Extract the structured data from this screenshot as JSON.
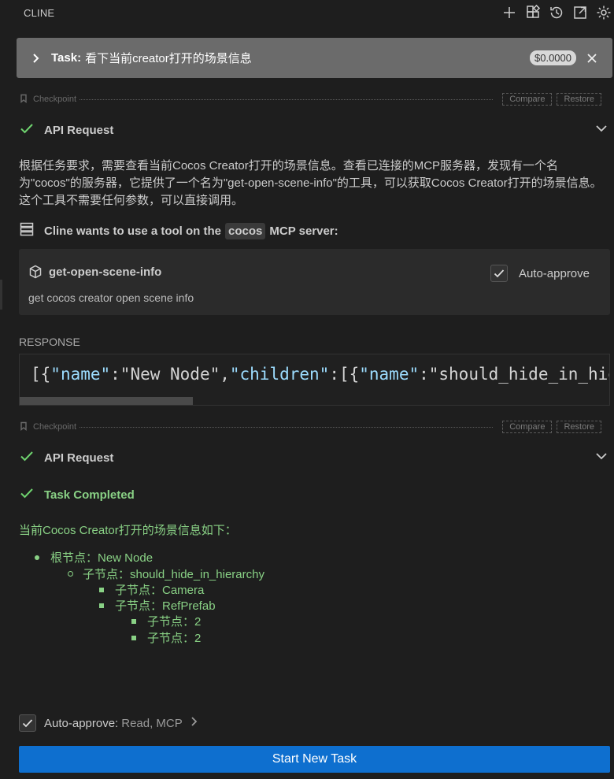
{
  "header": {
    "title": "CLINE",
    "icons": [
      "plus-icon",
      "grid-icon",
      "history-icon",
      "external-link-icon",
      "gear-icon"
    ]
  },
  "task": {
    "label": "Task:",
    "text": "看下当前creator打开的场景信息",
    "cost": "$0.0000"
  },
  "checkpoint": {
    "label": "Checkpoint",
    "compare": "Compare",
    "restore": "Restore"
  },
  "api_request_1": {
    "title": "API Request"
  },
  "reasoning": "根据任务要求，需要查看当前Cocos Creator打开的场景信息。查看已连接的MCP服务器，发现有一个名为\"cocos\"的服务器，它提供了一个名为\"get-open-scene-info\"的工具，可以获取Cocos Creator打开的场景信息。这个工具不需要任何参数，可以直接调用。",
  "tool_use": {
    "prefix": "Cline wants to use a tool on the",
    "server": "cocos",
    "suffix": "MCP server:"
  },
  "tool_card": {
    "name": "get-open-scene-info",
    "description": "get cocos creator open scene info",
    "auto_approve": "Auto-approve"
  },
  "response": {
    "label": "RESPONSE",
    "tokens": {
      "open": "[{",
      "key1": "\"name\"",
      "sep1": ":\"New Node\",",
      "key2": "\"children\"",
      "sep2": ":[{",
      "key3": "\"name\"",
      "sep3": ":\"should_hide_in_hie"
    }
  },
  "api_request_2": {
    "title": "API Request"
  },
  "completed": {
    "title": "Task Completed"
  },
  "result": {
    "intro": "当前Cocos Creator打开的场景信息如下：",
    "tree": [
      {
        "text": "根节点：New Node"
      },
      {
        "text": "子节点：should_hide_in_hierarchy"
      },
      {
        "text": "子节点：Camera"
      },
      {
        "text": "子节点：RefPrefab"
      },
      {
        "text": "子节点：2"
      },
      {
        "text": "子节点：2"
      }
    ]
  },
  "footer": {
    "auto_label": "Auto-approve:",
    "auto_value": "Read, MCP",
    "start_button": "Start New Task"
  }
}
